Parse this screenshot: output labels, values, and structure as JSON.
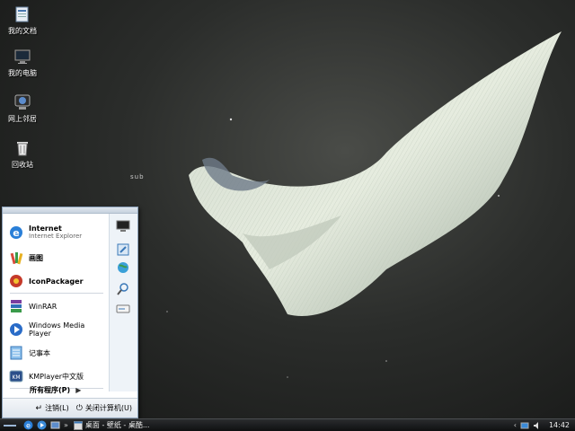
{
  "desktop": {
    "icons": [
      {
        "label": "我的文档",
        "icon": "documents-icon"
      },
      {
        "label": "我的电脑",
        "icon": "computer-icon"
      },
      {
        "label": "网上邻居",
        "icon": "network-icon"
      },
      {
        "label": "回收站",
        "icon": "recycle-bin-icon"
      }
    ],
    "wallpaper_text": "sub"
  },
  "start_menu": {
    "items": [
      {
        "title": "Internet",
        "subtitle": "Internet Explorer",
        "icon": "internet-explorer-icon"
      },
      {
        "title": "画图",
        "icon": "paint-icon"
      },
      {
        "title": "IconPackager",
        "icon": "iconpackager-icon"
      },
      {
        "title": "WinRAR",
        "icon": "winrar-icon"
      },
      {
        "title": "Windows Media Player",
        "icon": "media-player-icon"
      },
      {
        "title": "记事本",
        "icon": "notepad-icon"
      },
      {
        "title": "KMPlayer中文版",
        "icon": "kmplayer-icon"
      }
    ],
    "all_programs": "所有程序(P)",
    "right_icons": [
      "my-computer-icon",
      "control-panel-icon",
      "network-globe-icon",
      "search-icon",
      "run-icon"
    ],
    "logoff_label": "注销(L)",
    "shutdown_label": "关闭计算机(U)"
  },
  "taskbar": {
    "task_label": "桌面 - 壁纸 - 桌酷...",
    "clock": "14:42"
  },
  "colors": {
    "accent": "#3a7bd5",
    "taskbar": "#1a1b1c"
  }
}
